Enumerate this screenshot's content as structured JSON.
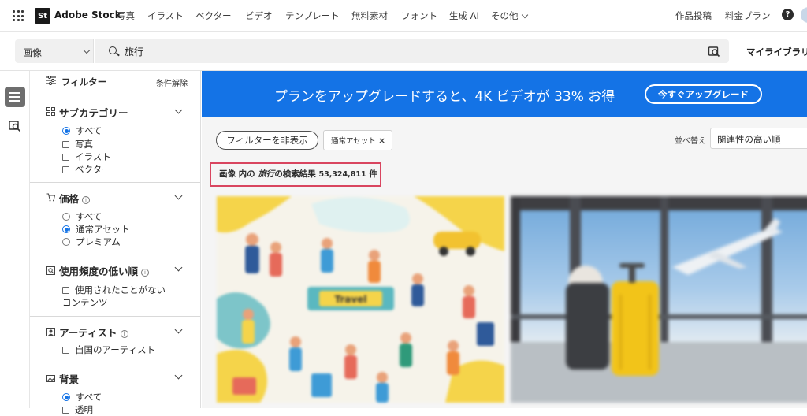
{
  "topnav": {
    "logo_mark": "St",
    "logo_text": "Adobe Stock",
    "items": [
      "写真",
      "イラスト",
      "ベクター",
      "ビデオ",
      "テンプレート",
      "無料素材",
      "フォント",
      "生成 AI",
      "その他"
    ],
    "right_items": [
      "作品投稿",
      "料金プラン"
    ],
    "help_label": "?"
  },
  "search": {
    "type_value": "画像",
    "query": "旅行",
    "my_library": "マイライブラリ"
  },
  "sidebar": {
    "title": "フィルター",
    "clear_label": "条件解除",
    "sections": [
      {
        "title": "サブカテゴリー",
        "options": [
          {
            "label": "すべて",
            "kind": "radio",
            "checked": true
          },
          {
            "label": "写真",
            "kind": "checkbox",
            "checked": false
          },
          {
            "label": "イラスト",
            "kind": "checkbox",
            "checked": false
          },
          {
            "label": "ベクター",
            "kind": "checkbox",
            "checked": false
          }
        ]
      },
      {
        "title": "価格",
        "info": "i",
        "options": [
          {
            "label": "すべて",
            "kind": "radio",
            "checked": false
          },
          {
            "label": "通常アセット",
            "kind": "radio",
            "checked": true
          },
          {
            "label": "プレミアム",
            "kind": "radio",
            "checked": false
          }
        ]
      },
      {
        "title": "使用頻度の低い順",
        "info": "i",
        "options": [
          {
            "label": "使用されたことがない",
            "label2": "コンテンツ",
            "kind": "checkbox",
            "checked": false
          }
        ]
      },
      {
        "title": "アーティスト",
        "info": "i",
        "options": [
          {
            "label": "自国のアーティスト",
            "kind": "checkbox",
            "checked": false
          }
        ]
      },
      {
        "title": "背景",
        "options": [
          {
            "label": "すべて",
            "kind": "radio",
            "checked": true
          },
          {
            "label": "透明",
            "kind": "checkbox",
            "checked": false
          }
        ]
      }
    ]
  },
  "banner": {
    "text": "プランをアップグレードすると、4K ビデオが 33% お得",
    "button": "今すぐアップグレード"
  },
  "toolbar": {
    "hide_filter": "フィルターを非表示",
    "chip": "通常アセット",
    "chip_close": "×",
    "sort_label": "並べ替え",
    "sort_value": "関連性の高い順"
  },
  "results": {
    "prefix": "画像 内の",
    "query": "旅行",
    "suffix": "の検索結果",
    "count": "53,324,811",
    "unit": "件"
  },
  "illustration": {
    "title": "Travel"
  },
  "colors": {
    "accent": "#1473e6",
    "highlight_border": "#d9455f"
  }
}
